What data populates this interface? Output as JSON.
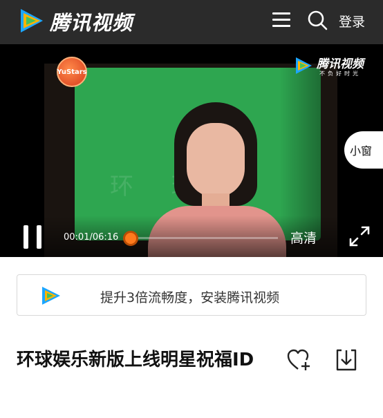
{
  "header": {
    "brand": "腾讯视频",
    "login_label": "登录",
    "icons": [
      "tencent-video-logo-icon",
      "menu-icon",
      "search-icon"
    ]
  },
  "player": {
    "badge_text": "YuStars",
    "watermark_brand": "腾讯视频",
    "watermark_slogan": "不负好时光",
    "mini_window_label": "小窗",
    "current_time": "00:01",
    "duration": "06:16",
    "time_separator": "/",
    "quality_label": "高清",
    "progress_fraction": 0.003,
    "colors": {
      "progress_knob": "#ff7a1c",
      "header_bg": "#2b2b2b"
    }
  },
  "banner": {
    "text": "提升3倍流畅度，安装腾讯视频"
  },
  "video": {
    "title": "环球娱乐新版上线明星祝福ID"
  }
}
